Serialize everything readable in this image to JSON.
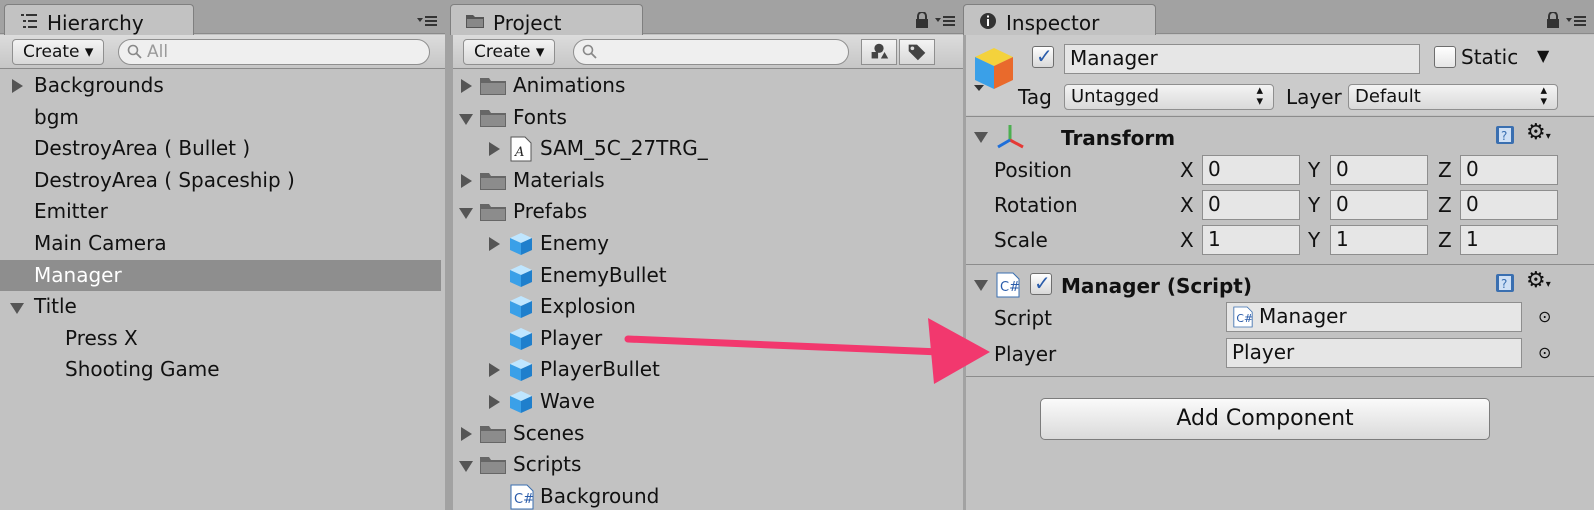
{
  "hierarchy": {
    "tab_label": "Hierarchy",
    "create_label": "Create",
    "search_placeholder": "All",
    "items": [
      {
        "label": "Backgrounds",
        "expander": "collapsed"
      },
      {
        "label": "bgm"
      },
      {
        "label": "DestroyArea ( Bullet )"
      },
      {
        "label": "DestroyArea ( Spaceship )"
      },
      {
        "label": "Emitter"
      },
      {
        "label": "Main Camera"
      },
      {
        "label": "Manager",
        "selected": true
      },
      {
        "label": "Title",
        "expander": "expanded"
      },
      {
        "label": "Press X"
      },
      {
        "label": "Shooting Game"
      }
    ]
  },
  "project": {
    "tab_label": "Project",
    "create_label": "Create",
    "search_value": "",
    "items": [
      {
        "label": "Animations",
        "icon": "folder-icon",
        "expander": "collapsed"
      },
      {
        "label": "Fonts",
        "icon": "folder-icon",
        "expander": "expanded"
      },
      {
        "label": "SAM_5C_27TRG_",
        "icon": "font-icon",
        "expander": "collapsed"
      },
      {
        "label": "Materials",
        "icon": "folder-icon",
        "expander": "collapsed"
      },
      {
        "label": "Prefabs",
        "icon": "folder-icon",
        "expander": "expanded"
      },
      {
        "label": "Enemy",
        "icon": "prefab-cube-icon",
        "expander": "collapsed"
      },
      {
        "label": "EnemyBullet",
        "icon": "prefab-cube-icon"
      },
      {
        "label": "Explosion",
        "icon": "prefab-cube-icon"
      },
      {
        "label": "Player",
        "icon": "prefab-cube-icon"
      },
      {
        "label": "PlayerBullet",
        "icon": "prefab-cube-icon",
        "expander": "collapsed"
      },
      {
        "label": "Wave",
        "icon": "prefab-cube-icon",
        "expander": "collapsed"
      },
      {
        "label": "Scenes",
        "icon": "folder-icon",
        "expander": "collapsed"
      },
      {
        "label": "Scripts",
        "icon": "folder-icon",
        "expander": "expanded"
      },
      {
        "label": "Background",
        "icon": "csharp-script-icon"
      }
    ]
  },
  "inspector": {
    "tab_label": "Inspector",
    "object_name": "Manager",
    "static_label": "Static",
    "tag_label": "Tag",
    "tag_value": "Untagged",
    "layer_label": "Layer",
    "layer_value": "Default",
    "transform": {
      "title": "Transform",
      "rows": [
        {
          "label": "Position",
          "x": "0",
          "y": "0",
          "z": "0"
        },
        {
          "label": "Rotation",
          "x": "0",
          "y": "0",
          "z": "0"
        },
        {
          "label": "Scale",
          "x": "1",
          "y": "1",
          "z": "1"
        }
      ],
      "axis_labels": [
        "X",
        "Y",
        "Z"
      ]
    },
    "script_component": {
      "title": "Manager (Script)",
      "script_label": "Script",
      "script_value": "Manager",
      "player_label": "Player",
      "player_value": "Player"
    },
    "add_component_label": "Add Component"
  },
  "annotation": {
    "arrow_color": "#f2386e"
  }
}
